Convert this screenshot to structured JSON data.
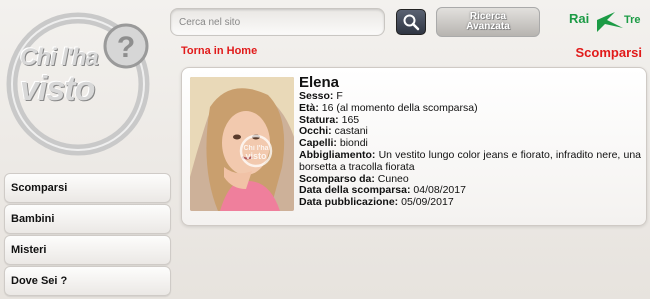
{
  "logo": {
    "line1": "Chi l'ha",
    "line2": "visto",
    "mark": "?"
  },
  "search": {
    "placeholder": "Cerca nel sito",
    "icon": "magnifier-icon",
    "advanced_label": "Ricerca\nAvanzata"
  },
  "brand": {
    "name_left": "Rai",
    "name_right": "Tre"
  },
  "nav": {
    "home_link": "Torna in Home",
    "section_title": "Scomparsi"
  },
  "menu": {
    "items": [
      {
        "label": "Scomparsi"
      },
      {
        "label": "Bambini"
      },
      {
        "label": "Misteri"
      },
      {
        "label": "Dove Sei ?"
      }
    ]
  },
  "person": {
    "name": "Elena",
    "photo_watermark_1": "Chi l'ha",
    "photo_watermark_2": "visto",
    "fields": [
      {
        "label": "Sesso:",
        "value": "F"
      },
      {
        "label": "Età:",
        "value": "16 (al momento della scomparsa)"
      },
      {
        "label": "Statura:",
        "value": "165"
      },
      {
        "label": "Occhi:",
        "value": "castani"
      },
      {
        "label": "Capelli:",
        "value": "biondi"
      },
      {
        "label": "Abbigliamento:",
        "value": "Un vestito lungo color jeans e fiorato, infradito nere, una borsetta a tracolla fiorata"
      },
      {
        "label": "Scomparso da:",
        "value": "Cuneo"
      },
      {
        "label": "Data della scomparsa:",
        "value": "04/08/2017"
      },
      {
        "label": "Data pubblicazione:",
        "value": "05/09/2017"
      }
    ]
  },
  "colors": {
    "accent_red": "#e11a1a",
    "rai_green": "#1c9b45"
  }
}
